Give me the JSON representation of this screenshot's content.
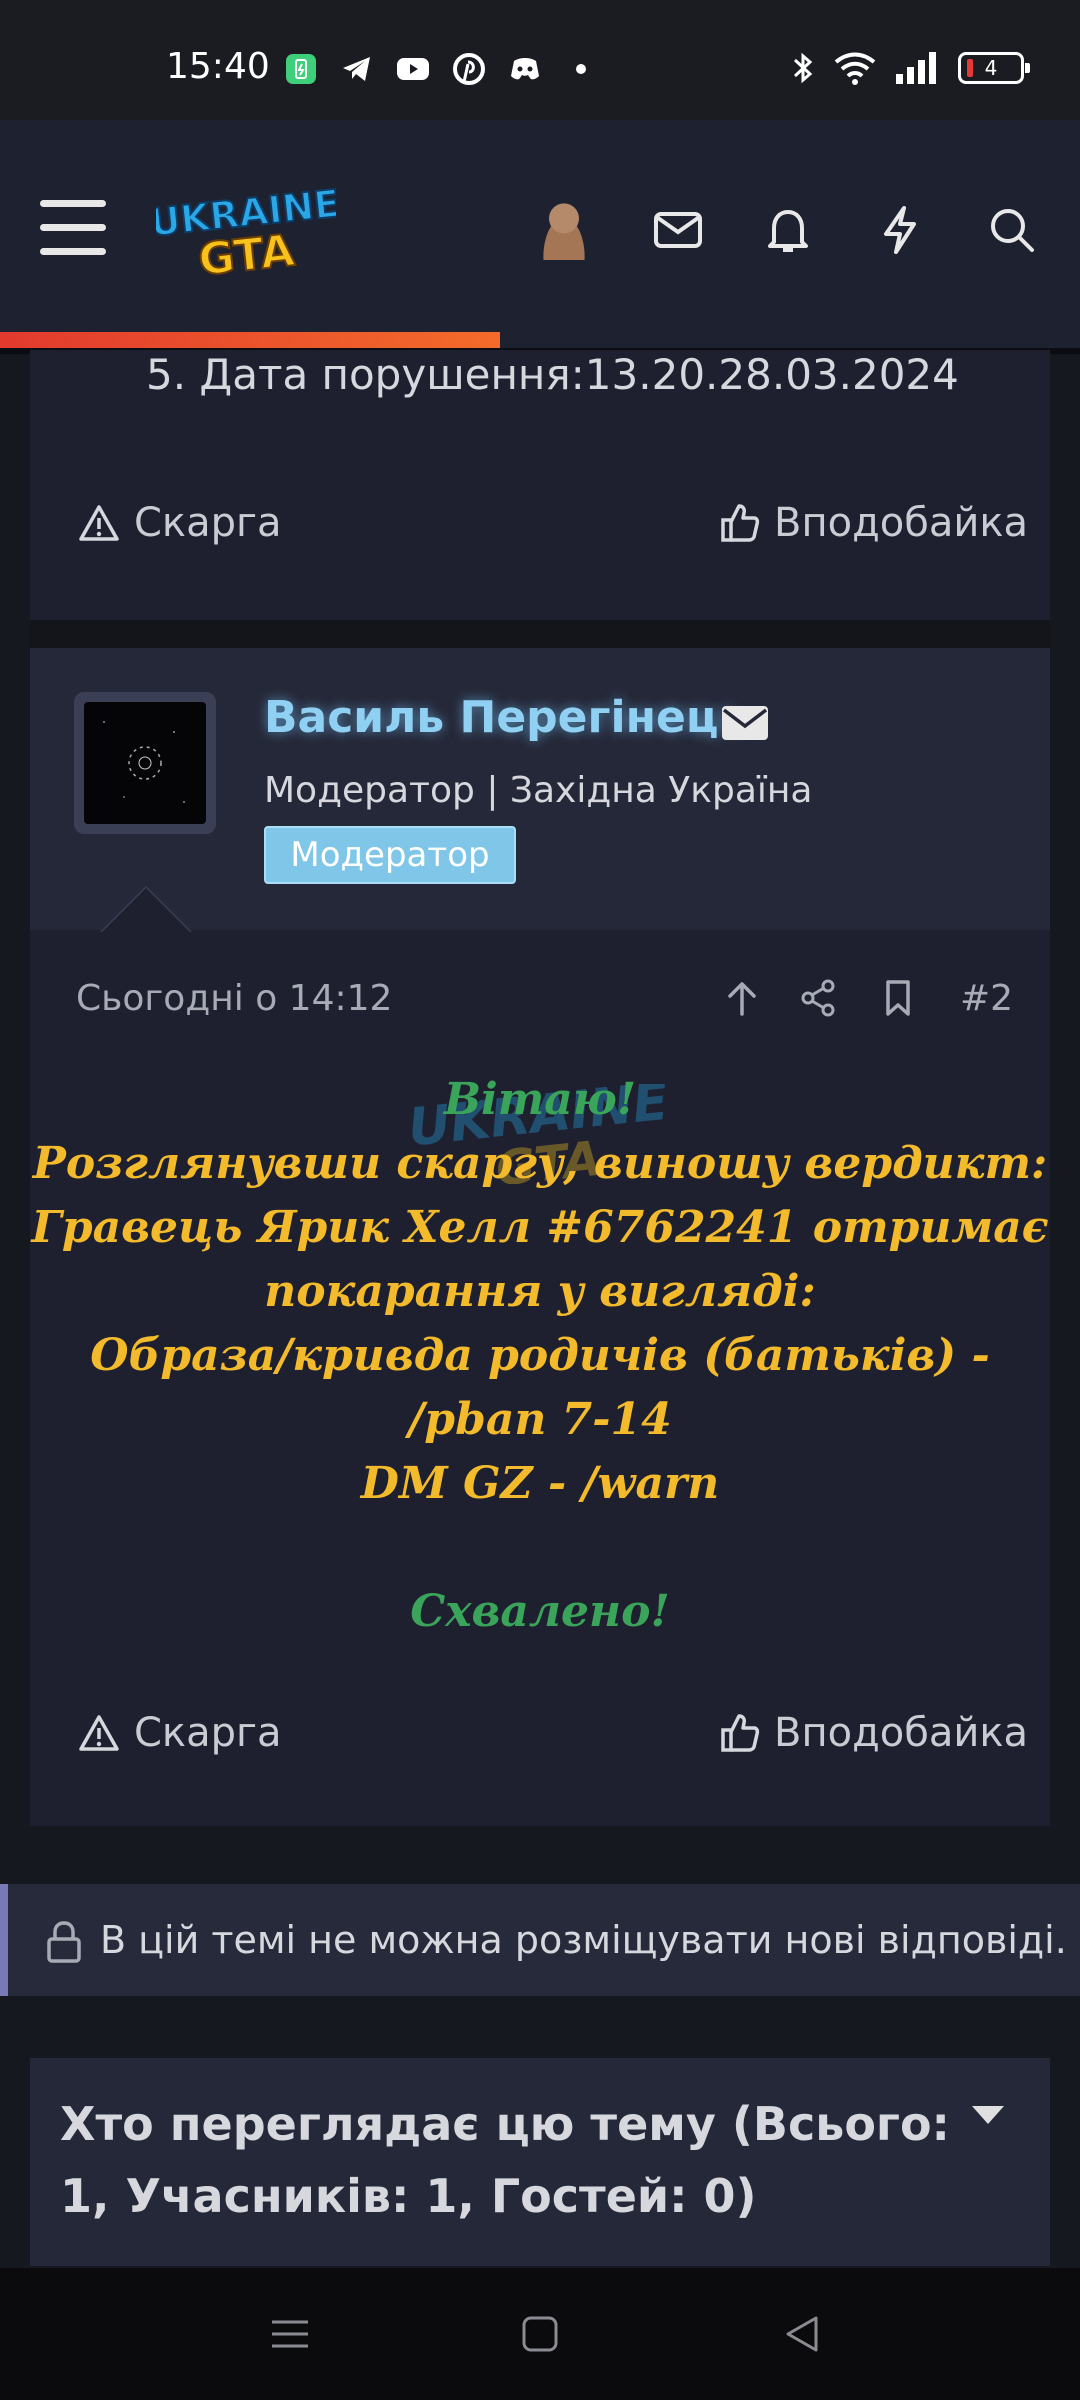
{
  "status_bar": {
    "time": "15:40",
    "battery_level": "4",
    "notification_icons": [
      "battery-saver-icon",
      "telegram-icon",
      "youtube-icon",
      "pinterest-icon",
      "discord-icon",
      "dot-icon"
    ],
    "system_icons": [
      "bluetooth-icon",
      "wifi-icon",
      "signal-icon",
      "battery-icon"
    ]
  },
  "header": {
    "logo_text": "UKRAINE GTA",
    "icons": [
      "menu-icon",
      "user-avatar",
      "mail-icon",
      "bell-icon",
      "bolt-icon",
      "search-icon"
    ],
    "accent_color": "#e23a2e"
  },
  "post1": {
    "text_line": "5. Дата порушення:13.20.28.03.2024",
    "report_label": "Скарга",
    "like_label": "Вподобайка"
  },
  "post2": {
    "username": "Василь Перегінець",
    "user_title": "Модератор | Західна Україна",
    "badge": "Модератор",
    "date": "Сьогодні о 14:12",
    "post_number": "#2",
    "body": {
      "greeting": "Вітаю!",
      "line1": "Розглянувши скаргу, виношу вердикт:",
      "line2": "Гравець Ярик Хелл #6762241 отримає",
      "line3": "покарання у вигляді:",
      "line4": "Образа/кривда родичів (батьків) -",
      "line5": "/pban 7-14",
      "line6": "DM GZ - /warn",
      "verdict": "Схвалено!"
    },
    "report_label": "Скарга",
    "like_label": "Вподобайка"
  },
  "locked_notice": {
    "text": "В цій темі не можна розміщувати нові відповіді."
  },
  "viewers": {
    "title": "Хто переглядає цю тему (Всього: 1, Учасників: 1, Гостей: 0)"
  },
  "colors": {
    "username": "#8fd0f3",
    "badge": "#7fc6e8",
    "green_text": "#3aa55a",
    "yellow_text": "#f3bb2b",
    "locked_border": "#7a79b8"
  }
}
